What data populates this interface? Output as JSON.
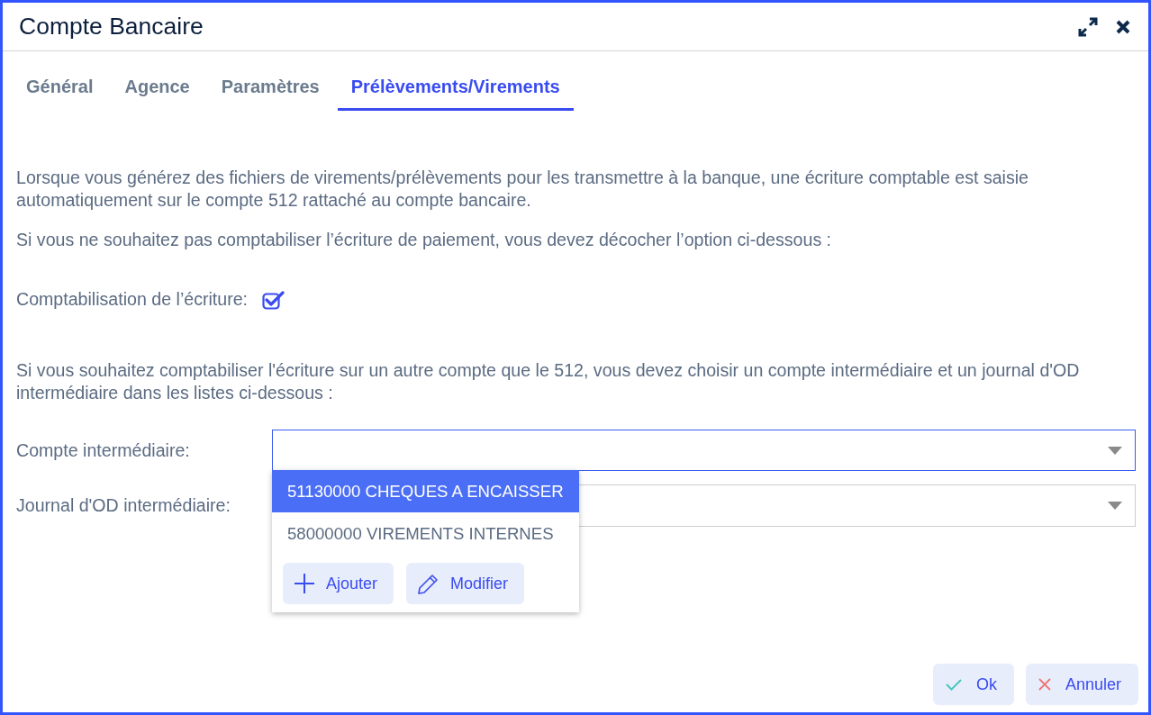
{
  "window": {
    "title": "Compte Bancaire"
  },
  "tabs": [
    {
      "label": "Général",
      "selected": false
    },
    {
      "label": "Agence",
      "selected": false
    },
    {
      "label": "Paramètres",
      "selected": false
    },
    {
      "label": "Prélèvements/Virements",
      "selected": true
    }
  ],
  "intro": [
    "Lorsque vous générez des fichiers de virements/prélèvements pour les transmettre à la banque, une écriture comptable est saisie automatiquement sur le compte 512 rattaché au compte bancaire.",
    "Si vous ne souhaitez pas comptabiliser l’écriture de paiement, vous devez décocher l’option ci-dessous :"
  ],
  "checkbox": {
    "label": "Comptabilisation de l’écriture:",
    "checked": true
  },
  "note": "Si vous souhaitez comptabiliser l'écriture sur un autre compte que le 512, vous devez choisir un compte intermédiaire et un journal d'OD intermédiaire dans les listes ci-dessous :",
  "fields": [
    {
      "label": "Compte intermédiaire:",
      "focused": true,
      "expanded": true,
      "options": [
        {
          "label": "51130000 CHEQUES A ENCAISSER",
          "selected": true
        },
        {
          "label": "58000000 VIREMENTS INTERNES",
          "selected": false
        }
      ],
      "actions": [
        {
          "label": "Ajouter",
          "kind": "add"
        },
        {
          "label": "Modifier",
          "kind": "edit"
        }
      ]
    },
    {
      "label": "Journal d'OD intermédiaire:",
      "focused": false,
      "expanded": false
    }
  ],
  "buttons": [
    {
      "label": "Ok",
      "kind": "ok"
    },
    {
      "label": "Annuler",
      "kind": "cancel"
    }
  ]
}
